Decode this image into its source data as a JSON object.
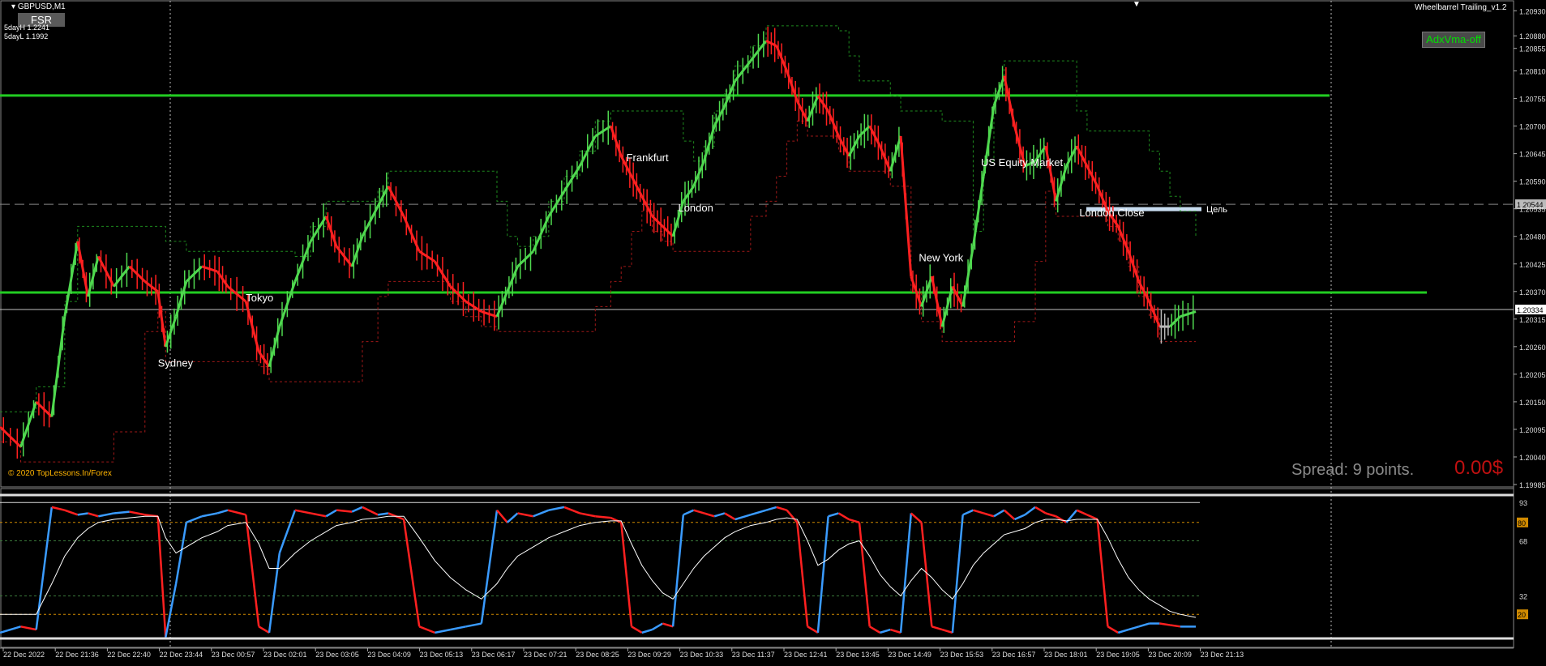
{
  "header": {
    "symbol": "GBPUSD,M1",
    "fsr_button": "FSR",
    "five_day_high": "5dayH 1.2241",
    "five_day_low": "5dayL 1.1992",
    "indicator_name": "Wheelbarrel Trailing_v1.2",
    "adx_button": "AdxVma-off",
    "copyright": "© 2020 TopLessons.In/Forex",
    "spread": "Spread: 9 points.",
    "pnl": "0.00$",
    "close_marker": "▼"
  },
  "colors": {
    "background": "#000000",
    "bull": "#4fd84f",
    "bear": "#ff2020",
    "neutral": "#b8b8b8",
    "level_line": "#22cc22",
    "osc_red": "#ff2020",
    "osc_blue": "#3a9bff",
    "osc_signal": "#ffffff",
    "osc_band": "#d08a00"
  },
  "sessions": [
    {
      "label": "Sydney",
      "x": 61,
      "y": 1.2022
    },
    {
      "label": "Tokyo",
      "x": 95,
      "y": 1.2035
    },
    {
      "label": "Frankfurt",
      "x": 242,
      "y": 1.2063
    },
    {
      "label": "London",
      "x": 262,
      "y": 1.2053
    },
    {
      "label": "New York",
      "x": 355,
      "y": 1.2043
    },
    {
      "label": "US Equity Market",
      "x": 379,
      "y": 1.2062
    },
    {
      "label": "London Close",
      "x": 417,
      "y": 1.2052
    }
  ],
  "target_label": "Цель",
  "chart_data": [
    {
      "type": "line",
      "title": "GBPUSD,M1",
      "note": "candles colored green (rising) / red (falling) / grey",
      "x": [
        0,
        8,
        14,
        20,
        25,
        30,
        34,
        38,
        44,
        50,
        56,
        61,
        64,
        68,
        72,
        78,
        84,
        88,
        95,
        100,
        104,
        108,
        114,
        120,
        126,
        130,
        136,
        140,
        146,
        150,
        156,
        162,
        168,
        174,
        180,
        186,
        192,
        196,
        200,
        206,
        212,
        218,
        224,
        230,
        236,
        240,
        244,
        248,
        252,
        256,
        260,
        264,
        268,
        272,
        276,
        280,
        284,
        290,
        296,
        300,
        304,
        308,
        312,
        316,
        320,
        324,
        328,
        332,
        336,
        340,
        344,
        348,
        352,
        356,
        360,
        364,
        368,
        372,
        376,
        380,
        384,
        388,
        392,
        396,
        400,
        404,
        408,
        412,
        416,
        420,
        424,
        428,
        432,
        436,
        440,
        444,
        448,
        452,
        456,
        462
      ],
      "values": [
        1.201,
        1.2006,
        1.2015,
        1.2012,
        1.2032,
        1.2047,
        1.2036,
        1.2044,
        1.2038,
        1.2042,
        1.2039,
        1.2037,
        1.2026,
        1.2032,
        1.2039,
        1.2042,
        1.2041,
        1.2038,
        1.2035,
        1.2025,
        1.2022,
        1.203,
        1.2039,
        1.2047,
        1.2052,
        1.2046,
        1.2042,
        1.2048,
        1.2054,
        1.2058,
        1.2052,
        1.2045,
        1.2043,
        1.2038,
        1.2035,
        1.2033,
        1.2032,
        1.2037,
        1.2042,
        1.2045,
        1.2052,
        1.2057,
        1.2062,
        1.2068,
        1.207,
        1.2064,
        1.206,
        1.2056,
        1.2052,
        1.205,
        1.2048,
        1.2055,
        1.2058,
        1.2063,
        1.207,
        1.2074,
        1.2079,
        1.2083,
        1.2087,
        1.2086,
        1.2081,
        1.2075,
        1.2071,
        1.2076,
        1.2073,
        1.2068,
        1.2064,
        1.2068,
        1.207,
        1.2066,
        1.2061,
        1.2068,
        1.204,
        1.2034,
        1.204,
        1.203,
        1.2038,
        1.2034,
        1.2046,
        1.206,
        1.2074,
        1.208,
        1.207,
        1.2062,
        1.2063,
        1.2066,
        1.2055,
        1.2062,
        1.2066,
        1.2062,
        1.2058,
        1.2053,
        1.205,
        1.2045,
        1.2039,
        1.2035,
        1.203,
        1.203,
        1.2032,
        1.2033
      ],
      "ylim": [
        1.19985,
        1.20945
      ],
      "yticks": [
        "1.20930",
        "1.20880",
        "1.20855",
        "1.20810",
        "1.20755",
        "1.20700",
        "1.20645",
        "1.20590",
        "1.20544",
        "1.20535",
        "1.20480",
        "1.20425",
        "1.20370",
        "1.20334",
        "1.20315",
        "1.20260",
        "1.20205",
        "1.20150",
        "1.20095",
        "1.20040",
        "1.19985"
      ],
      "current_price": "1.20334",
      "current_price_value": 1.20334,
      "target_price": "1.20544",
      "target_price_value": 1.20544,
      "levels": [
        {
          "name": "upper-level",
          "value": 1.20761
        },
        {
          "name": "lower-level",
          "value": 1.20368
        }
      ],
      "grid": false
    },
    {
      "type": "line",
      "note": "oscillator sub-window, fast line colored blue/red plus white signal line",
      "x": [
        0,
        8,
        14,
        20,
        25,
        30,
        34,
        38,
        44,
        50,
        56,
        61,
        64,
        68,
        72,
        78,
        84,
        88,
        95,
        100,
        104,
        108,
        114,
        120,
        126,
        130,
        136,
        140,
        146,
        150,
        156,
        162,
        168,
        174,
        180,
        186,
        192,
        196,
        200,
        206,
        212,
        218,
        224,
        230,
        236,
        240,
        244,
        248,
        252,
        256,
        260,
        264,
        268,
        272,
        276,
        280,
        284,
        290,
        296,
        300,
        304,
        308,
        312,
        316,
        320,
        324,
        328,
        332,
        336,
        340,
        344,
        348,
        352,
        356,
        360,
        364,
        368,
        372,
        376,
        380,
        384,
        388,
        392,
        396,
        400,
        404,
        408,
        412,
        416,
        420,
        424,
        428,
        432,
        436,
        440,
        444,
        448,
        452,
        456,
        462
      ],
      "series": [
        {
          "values": [
            8,
            12,
            10,
            90,
            88,
            85,
            86,
            84,
            86,
            87,
            85,
            84,
            5,
            40,
            80,
            84,
            86,
            88,
            85,
            12,
            8,
            60,
            88,
            86,
            84,
            88,
            87,
            90,
            85,
            86,
            82,
            12,
            8,
            10,
            12,
            14,
            88,
            80,
            86,
            84,
            88,
            90,
            86,
            84,
            83,
            80,
            12,
            8,
            10,
            14,
            12,
            85,
            88,
            86,
            84,
            86,
            82,
            85,
            88,
            90,
            88,
            80,
            12,
            8,
            84,
            86,
            82,
            80,
            12,
            8,
            10,
            8,
            86,
            80,
            12,
            10,
            8,
            85,
            88,
            86,
            84,
            88,
            82,
            85,
            90,
            86,
            84,
            80,
            88,
            85,
            82,
            12,
            8,
            10,
            12,
            14,
            14,
            13,
            12,
            12
          ]
        },
        {
          "values": [
            20,
            20,
            20,
            40,
            58,
            70,
            76,
            80,
            82,
            83,
            84,
            84,
            70,
            60,
            64,
            70,
            74,
            78,
            80,
            66,
            50,
            50,
            60,
            68,
            74,
            78,
            80,
            82,
            83,
            84,
            84,
            70,
            55,
            44,
            36,
            30,
            40,
            50,
            58,
            64,
            70,
            74,
            78,
            80,
            81,
            81,
            66,
            52,
            42,
            34,
            30,
            40,
            50,
            58,
            64,
            70,
            74,
            78,
            80,
            82,
            83,
            82,
            68,
            52,
            56,
            62,
            66,
            68,
            58,
            46,
            38,
            32,
            42,
            50,
            44,
            36,
            30,
            40,
            52,
            60,
            66,
            72,
            74,
            76,
            80,
            82,
            82,
            81,
            82,
            82,
            82,
            70,
            56,
            44,
            36,
            30,
            26,
            22,
            20,
            18
          ]
        }
      ],
      "ylim": [
        0,
        100
      ],
      "yticks": [
        "93",
        "80",
        "68",
        "32",
        "20"
      ],
      "bands": [
        20,
        32,
        68,
        80,
        93
      ]
    }
  ],
  "x_axis_labels": [
    "22 Dec 2022",
    "22 Dec 21:36",
    "22 Dec 22:40",
    "22 Dec 23:44",
    "23 Dec 00:57",
    "23 Dec 02:01",
    "23 Dec 03:05",
    "23 Dec 04:09",
    "23 Dec 05:13",
    "23 Dec 06:17",
    "23 Dec 07:21",
    "23 Dec 08:25",
    "23 Dec 09:29",
    "23 Dec 10:33",
    "23 Dec 11:37",
    "23 Dec 12:41",
    "23 Dec 13:45",
    "23 Dec 14:49",
    "23 Dec 15:53",
    "23 Dec 16:57",
    "23 Dec 18:01",
    "23 Dec 19:05",
    "23 Dec 20:09",
    "23 Dec 21:13"
  ]
}
